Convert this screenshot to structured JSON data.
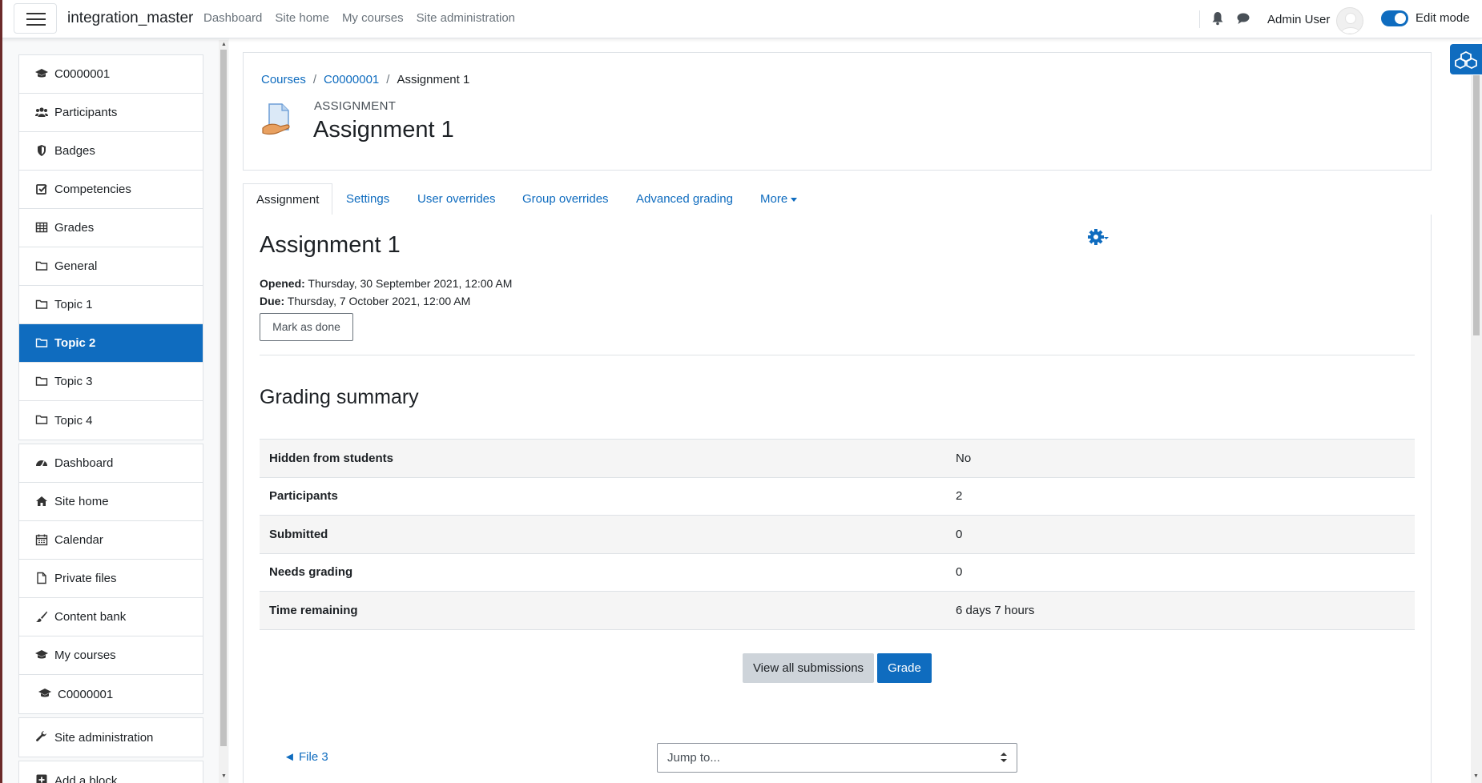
{
  "navbar": {
    "site_name": "integration_master",
    "links": [
      "Dashboard",
      "Site home",
      "My courses",
      "Site administration"
    ],
    "user_name": "Admin User",
    "edit_mode_label": "Edit mode",
    "edit_mode_on": true
  },
  "drawer": {
    "course_block": [
      {
        "label": "C0000001",
        "icon": "graduation-cap-icon"
      },
      {
        "label": "Participants",
        "icon": "users-icon"
      },
      {
        "label": "Badges",
        "icon": "shield-icon"
      },
      {
        "label": "Competencies",
        "icon": "checkbox-icon"
      },
      {
        "label": "Grades",
        "icon": "table-icon"
      },
      {
        "label": "General",
        "icon": "folder-icon"
      },
      {
        "label": "Topic 1",
        "icon": "folder-icon"
      },
      {
        "label": "Topic 2",
        "icon": "folder-icon",
        "active": true
      },
      {
        "label": "Topic 3",
        "icon": "folder-icon"
      },
      {
        "label": "Topic 4",
        "icon": "folder-icon"
      }
    ],
    "site_block": [
      {
        "label": "Dashboard",
        "icon": "dashboard-icon"
      },
      {
        "label": "Site home",
        "icon": "home-icon"
      },
      {
        "label": "Calendar",
        "icon": "calendar-icon"
      },
      {
        "label": "Private files",
        "icon": "file-icon"
      },
      {
        "label": "Content bank",
        "icon": "brush-icon"
      },
      {
        "label": "My courses",
        "icon": "graduation-cap-icon"
      },
      {
        "label": "C0000001",
        "icon": "graduation-cap-icon"
      }
    ],
    "admin_label": "Site administration",
    "add_block_label": "Add a block"
  },
  "header": {
    "breadcrumb": [
      "Courses",
      "C0000001",
      "Assignment 1"
    ],
    "module_type": "ASSIGNMENT",
    "title": "Assignment 1"
  },
  "tabs": {
    "assignment": "Assignment",
    "settings": "Settings",
    "user_overrides": "User overrides",
    "group_overrides": "Group overrides",
    "advanced_grading": "Advanced grading",
    "more": "More"
  },
  "activity": {
    "title": "Assignment 1",
    "opened_label": "Opened:",
    "opened_value": "Thursday, 30 September 2021, 12:00 AM",
    "due_label": "Due:",
    "due_value": "Thursday, 7 October 2021, 12:00 AM",
    "mark_done": "Mark as done"
  },
  "grading": {
    "title": "Grading summary",
    "rows": [
      {
        "key": "Hidden from students",
        "value": "No"
      },
      {
        "key": "Participants",
        "value": "2"
      },
      {
        "key": "Submitted",
        "value": "0"
      },
      {
        "key": "Needs grading",
        "value": "0"
      },
      {
        "key": "Time remaining",
        "value": "6 days 7 hours"
      }
    ],
    "view_all": "View all submissions",
    "grade": "Grade"
  },
  "footer_nav": {
    "prev": "◄ File 3",
    "jump_placeholder": "Jump to..."
  },
  "colors": {
    "primary": "#0f6cbf",
    "text": "#1d2125",
    "border": "#dee2e6"
  }
}
